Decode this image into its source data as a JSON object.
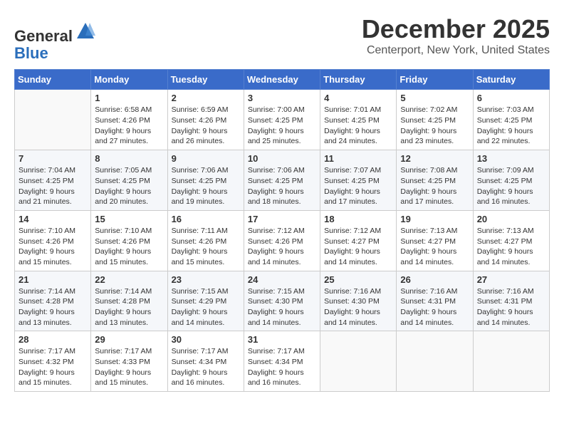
{
  "logo": {
    "general": "General",
    "blue": "Blue"
  },
  "header": {
    "month": "December 2025",
    "location": "Centerport, New York, United States"
  },
  "weekdays": [
    "Sunday",
    "Monday",
    "Tuesday",
    "Wednesday",
    "Thursday",
    "Friday",
    "Saturday"
  ],
  "weeks": [
    [
      {
        "day": "",
        "empty": true
      },
      {
        "day": "1",
        "sunrise": "Sunrise: 6:58 AM",
        "sunset": "Sunset: 4:26 PM",
        "daylight": "Daylight: 9 hours and 27 minutes."
      },
      {
        "day": "2",
        "sunrise": "Sunrise: 6:59 AM",
        "sunset": "Sunset: 4:26 PM",
        "daylight": "Daylight: 9 hours and 26 minutes."
      },
      {
        "day": "3",
        "sunrise": "Sunrise: 7:00 AM",
        "sunset": "Sunset: 4:25 PM",
        "daylight": "Daylight: 9 hours and 25 minutes."
      },
      {
        "day": "4",
        "sunrise": "Sunrise: 7:01 AM",
        "sunset": "Sunset: 4:25 PM",
        "daylight": "Daylight: 9 hours and 24 minutes."
      },
      {
        "day": "5",
        "sunrise": "Sunrise: 7:02 AM",
        "sunset": "Sunset: 4:25 PM",
        "daylight": "Daylight: 9 hours and 23 minutes."
      },
      {
        "day": "6",
        "sunrise": "Sunrise: 7:03 AM",
        "sunset": "Sunset: 4:25 PM",
        "daylight": "Daylight: 9 hours and 22 minutes."
      }
    ],
    [
      {
        "day": "7",
        "sunrise": "Sunrise: 7:04 AM",
        "sunset": "Sunset: 4:25 PM",
        "daylight": "Daylight: 9 hours and 21 minutes."
      },
      {
        "day": "8",
        "sunrise": "Sunrise: 7:05 AM",
        "sunset": "Sunset: 4:25 PM",
        "daylight": "Daylight: 9 hours and 20 minutes."
      },
      {
        "day": "9",
        "sunrise": "Sunrise: 7:06 AM",
        "sunset": "Sunset: 4:25 PM",
        "daylight": "Daylight: 9 hours and 19 minutes."
      },
      {
        "day": "10",
        "sunrise": "Sunrise: 7:06 AM",
        "sunset": "Sunset: 4:25 PM",
        "daylight": "Daylight: 9 hours and 18 minutes."
      },
      {
        "day": "11",
        "sunrise": "Sunrise: 7:07 AM",
        "sunset": "Sunset: 4:25 PM",
        "daylight": "Daylight: 9 hours and 17 minutes."
      },
      {
        "day": "12",
        "sunrise": "Sunrise: 7:08 AM",
        "sunset": "Sunset: 4:25 PM",
        "daylight": "Daylight: 9 hours and 17 minutes."
      },
      {
        "day": "13",
        "sunrise": "Sunrise: 7:09 AM",
        "sunset": "Sunset: 4:25 PM",
        "daylight": "Daylight: 9 hours and 16 minutes."
      }
    ],
    [
      {
        "day": "14",
        "sunrise": "Sunrise: 7:10 AM",
        "sunset": "Sunset: 4:26 PM",
        "daylight": "Daylight: 9 hours and 15 minutes."
      },
      {
        "day": "15",
        "sunrise": "Sunrise: 7:10 AM",
        "sunset": "Sunset: 4:26 PM",
        "daylight": "Daylight: 9 hours and 15 minutes."
      },
      {
        "day": "16",
        "sunrise": "Sunrise: 7:11 AM",
        "sunset": "Sunset: 4:26 PM",
        "daylight": "Daylight: 9 hours and 15 minutes."
      },
      {
        "day": "17",
        "sunrise": "Sunrise: 7:12 AM",
        "sunset": "Sunset: 4:26 PM",
        "daylight": "Daylight: 9 hours and 14 minutes."
      },
      {
        "day": "18",
        "sunrise": "Sunrise: 7:12 AM",
        "sunset": "Sunset: 4:27 PM",
        "daylight": "Daylight: 9 hours and 14 minutes."
      },
      {
        "day": "19",
        "sunrise": "Sunrise: 7:13 AM",
        "sunset": "Sunset: 4:27 PM",
        "daylight": "Daylight: 9 hours and 14 minutes."
      },
      {
        "day": "20",
        "sunrise": "Sunrise: 7:13 AM",
        "sunset": "Sunset: 4:27 PM",
        "daylight": "Daylight: 9 hours and 14 minutes."
      }
    ],
    [
      {
        "day": "21",
        "sunrise": "Sunrise: 7:14 AM",
        "sunset": "Sunset: 4:28 PM",
        "daylight": "Daylight: 9 hours and 13 minutes."
      },
      {
        "day": "22",
        "sunrise": "Sunrise: 7:14 AM",
        "sunset": "Sunset: 4:28 PM",
        "daylight": "Daylight: 9 hours and 13 minutes."
      },
      {
        "day": "23",
        "sunrise": "Sunrise: 7:15 AM",
        "sunset": "Sunset: 4:29 PM",
        "daylight": "Daylight: 9 hours and 14 minutes."
      },
      {
        "day": "24",
        "sunrise": "Sunrise: 7:15 AM",
        "sunset": "Sunset: 4:30 PM",
        "daylight": "Daylight: 9 hours and 14 minutes."
      },
      {
        "day": "25",
        "sunrise": "Sunrise: 7:16 AM",
        "sunset": "Sunset: 4:30 PM",
        "daylight": "Daylight: 9 hours and 14 minutes."
      },
      {
        "day": "26",
        "sunrise": "Sunrise: 7:16 AM",
        "sunset": "Sunset: 4:31 PM",
        "daylight": "Daylight: 9 hours and 14 minutes."
      },
      {
        "day": "27",
        "sunrise": "Sunrise: 7:16 AM",
        "sunset": "Sunset: 4:31 PM",
        "daylight": "Daylight: 9 hours and 14 minutes."
      }
    ],
    [
      {
        "day": "28",
        "sunrise": "Sunrise: 7:17 AM",
        "sunset": "Sunset: 4:32 PM",
        "daylight": "Daylight: 9 hours and 15 minutes."
      },
      {
        "day": "29",
        "sunrise": "Sunrise: 7:17 AM",
        "sunset": "Sunset: 4:33 PM",
        "daylight": "Daylight: 9 hours and 15 minutes."
      },
      {
        "day": "30",
        "sunrise": "Sunrise: 7:17 AM",
        "sunset": "Sunset: 4:34 PM",
        "daylight": "Daylight: 9 hours and 16 minutes."
      },
      {
        "day": "31",
        "sunrise": "Sunrise: 7:17 AM",
        "sunset": "Sunset: 4:34 PM",
        "daylight": "Daylight: 9 hours and 16 minutes."
      },
      {
        "day": "",
        "empty": true
      },
      {
        "day": "",
        "empty": true
      },
      {
        "day": "",
        "empty": true
      }
    ]
  ]
}
